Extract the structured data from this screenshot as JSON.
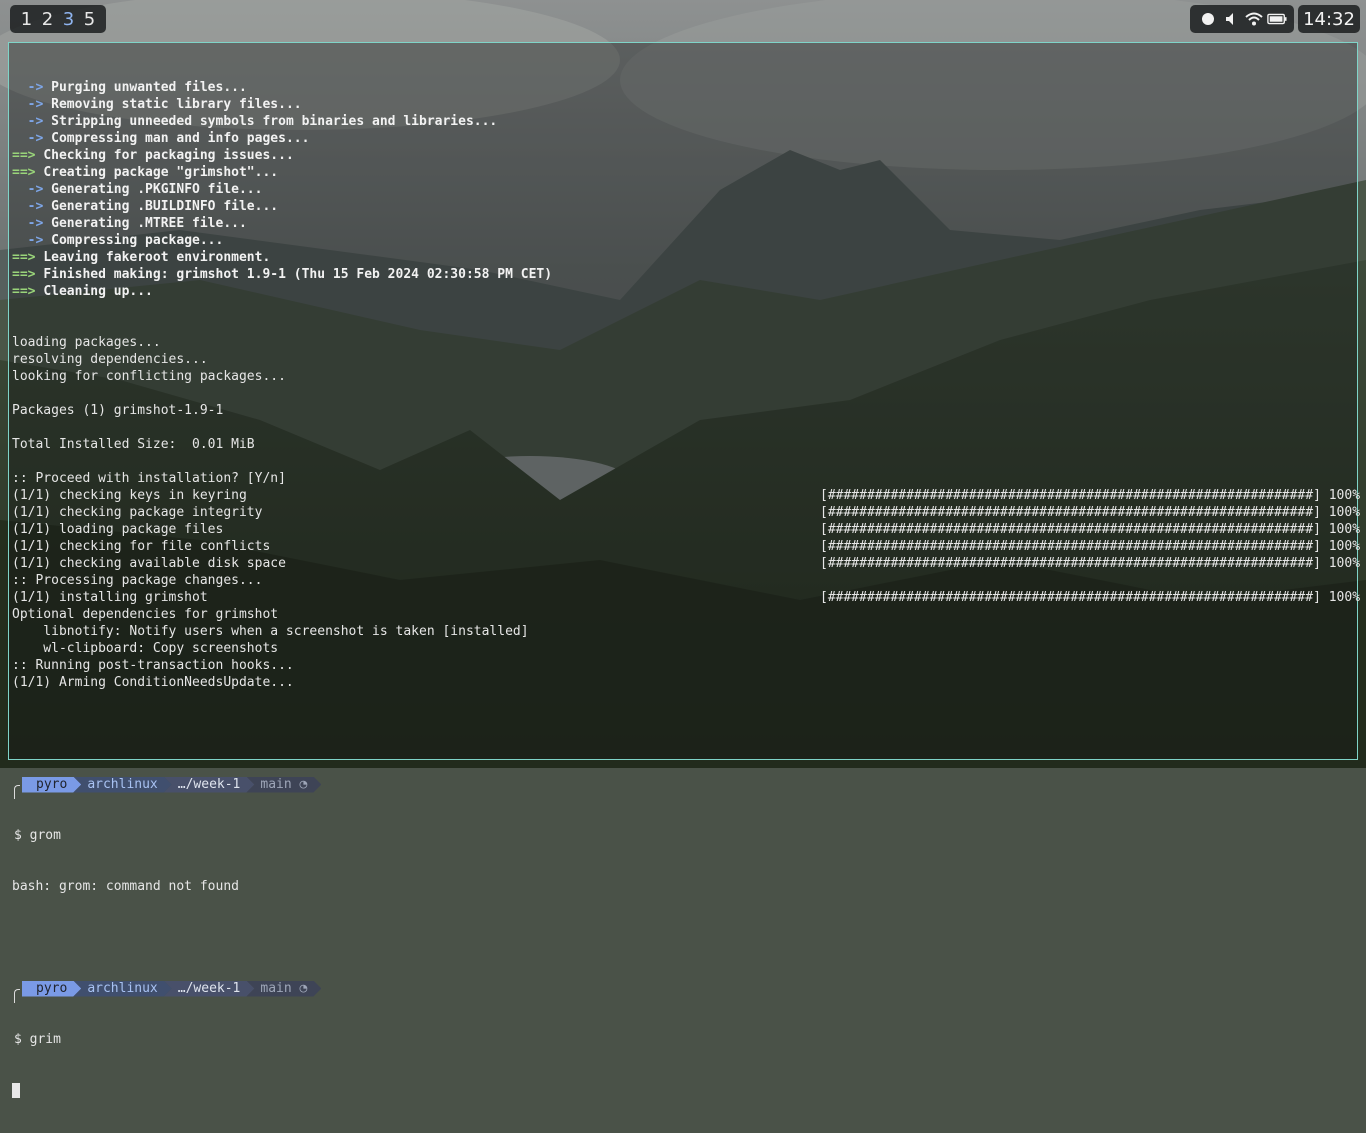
{
  "workspaces": {
    "items": [
      "1",
      "2",
      "3",
      "5"
    ],
    "active": "3"
  },
  "tray": {
    "icons": [
      "record-dot-icon",
      "volume-muted-icon",
      "wifi-icon",
      "battery-icon"
    ]
  },
  "clock": {
    "time": "14:32"
  },
  "terminal": {
    "build_lines": [
      {
        "style": "arrow",
        "marker": "  ->",
        "text": "Purging unwanted files..."
      },
      {
        "style": "arrow",
        "marker": "  ->",
        "text": "Removing static library files..."
      },
      {
        "style": "arrow",
        "marker": "  ->",
        "text": "Stripping unneeded symbols from binaries and libraries..."
      },
      {
        "style": "arrow",
        "marker": "  ->",
        "text": "Compressing man and info pages..."
      },
      {
        "style": "big",
        "marker": "==>",
        "text": "Checking for packaging issues..."
      },
      {
        "style": "big",
        "marker": "==>",
        "text": "Creating package \"grimshot\"..."
      },
      {
        "style": "arrow",
        "marker": "  ->",
        "text": "Generating .PKGINFO file..."
      },
      {
        "style": "arrow",
        "marker": "  ->",
        "text": "Generating .BUILDINFO file..."
      },
      {
        "style": "arrow",
        "marker": "  ->",
        "text": "Generating .MTREE file..."
      },
      {
        "style": "arrow",
        "marker": "  ->",
        "text": "Compressing package..."
      },
      {
        "style": "big",
        "marker": "==>",
        "text": "Leaving fakeroot environment."
      },
      {
        "style": "big",
        "marker": "==>",
        "text": "Finished making: grimshot 1.9-1 (Thu 15 Feb 2024 02:30:58 PM CET)"
      },
      {
        "style": "big",
        "marker": "==>",
        "text": "Cleaning up..."
      }
    ],
    "pacman_lines": [
      {
        "text": "loading packages..."
      },
      {
        "text": "resolving dependencies..."
      },
      {
        "text": "looking for conflicting packages..."
      },
      {
        "text": ""
      },
      {
        "text": "Packages (1) grimshot-1.9-1"
      },
      {
        "text": ""
      },
      {
        "text": "Total Installed Size:  0.01 MiB"
      },
      {
        "text": ""
      },
      {
        "text": ":: Proceed with installation? [Y/n]"
      },
      {
        "text": "(1/1) checking keys in keyring",
        "bar": "[##############################################################] 100%"
      },
      {
        "text": "(1/1) checking package integrity",
        "bar": "[##############################################################] 100%"
      },
      {
        "text": "(1/1) loading package files",
        "bar": "[##############################################################] 100%"
      },
      {
        "text": "(1/1) checking for file conflicts",
        "bar": "[##############################################################] 100%"
      },
      {
        "text": "(1/1) checking available disk space",
        "bar": "[##############################################################] 100%"
      },
      {
        "text": ":: Processing package changes..."
      },
      {
        "text": "(1/1) installing grimshot",
        "bar": "[##############################################################] 100%"
      },
      {
        "text": "Optional dependencies for grimshot"
      },
      {
        "text": "    libnotify: Notify users when a screenshot is taken [installed]"
      },
      {
        "text": "    wl-clipboard: Copy screenshots"
      },
      {
        "text": ":: Running post-transaction hooks..."
      },
      {
        "text": "(1/1) Arming ConditionNeedsUpdate..."
      }
    ],
    "prompt": {
      "user": "pyro",
      "host": "archlinux",
      "dir": "…/week-1",
      "git": "main ◔"
    },
    "command1": "$ grom",
    "error1": "bash: grom: command not found",
    "command2": "$ grim"
  }
}
